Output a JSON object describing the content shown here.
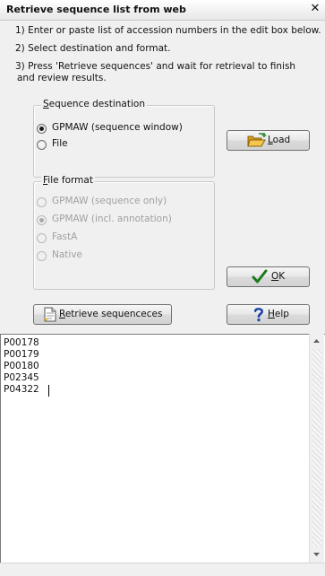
{
  "window": {
    "title": "Retrieve sequence list from web",
    "close_glyph": "✕"
  },
  "instructions": {
    "step1": "1) Enter or paste list of accession numbers in the edit box below.",
    "step2": "2) Select destination and format.",
    "step3_line1": "3) Press 'Retrieve sequences' and wait for retrieval to finish",
    "step3_line2": "and review results."
  },
  "destination_group": {
    "title_accel": "S",
    "title_rest": "equence destination",
    "options": [
      {
        "label": "GPMAW (sequence window)",
        "selected": true
      },
      {
        "label": "File",
        "selected": false
      }
    ]
  },
  "format_group": {
    "title_accel": "F",
    "title_rest": "ile format",
    "disabled": true,
    "options": [
      {
        "label": "GPMAW (sequence only)",
        "selected": false
      },
      {
        "label": "GPMAW (incl. annotation)",
        "selected": true
      },
      {
        "label": "FastA",
        "selected": false
      },
      {
        "label": "Native",
        "selected": false
      }
    ]
  },
  "buttons": {
    "load": {
      "accel": "L",
      "rest": "oad",
      "icon": "folder-open-icon"
    },
    "ok": {
      "accel": "O",
      "rest": "K",
      "icon": "checkmark-icon"
    },
    "retrieve": {
      "accel": "R",
      "rest": "etrieve sequenceces",
      "icon": "document-icon"
    },
    "help": {
      "accel": "H",
      "rest": "elp",
      "icon": "question-mark-icon"
    }
  },
  "accession_editor": {
    "lines": [
      "P00178",
      "P00179",
      "P00180",
      "P02345",
      "P04322"
    ]
  },
  "colors": {
    "dialog_bg": "#f0f0f0",
    "ok_check": "#1a7a1a",
    "help_question": "#1a3fa8",
    "folder": "#e8b23a"
  }
}
